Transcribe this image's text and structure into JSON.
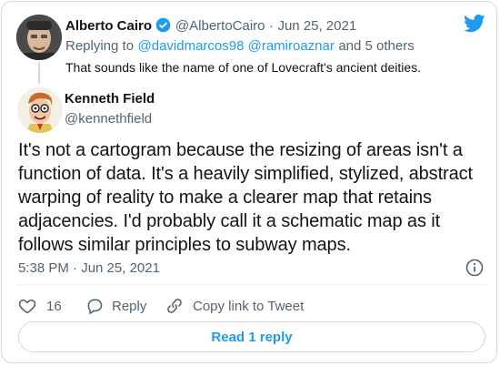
{
  "parent_tweet": {
    "author_name": "Alberto Cairo",
    "author_handle": "@AlbertoCairo",
    "separator": "·",
    "date": "Jun 25, 2021",
    "replying_prefix": "Replying to",
    "replying_to": "@davidmarcos98 @ramiroaznar",
    "replying_suffix": "and 5 others",
    "text": "That sounds like the name of one of Lovecraft's ancient deities."
  },
  "tweet": {
    "author_name": "Kenneth Field",
    "author_handle": "@kennethfield",
    "text": "It's not a cartogram because the resizing of areas isn't a function of data. It's a heavily simplified, stylized, abstract warping of reality to make a clearer map that retains adjacencies. I'd probably call it a schematic map as it follows similar principles to subway maps.",
    "timestamp": "5:38 PM · Jun 25, 2021"
  },
  "actions": {
    "like_count": "16",
    "reply_label": "Reply",
    "copy_label": "Copy link to Tweet"
  },
  "read_replies_label": "Read 1 reply",
  "colors": {
    "accent": "#1d9bf0",
    "text": "#0f1419",
    "muted": "#536471",
    "border": "#cfd9de"
  },
  "icons": [
    "twitter-bird-icon",
    "verified-badge-icon",
    "info-icon",
    "heart-icon",
    "reply-icon",
    "link-icon"
  ]
}
